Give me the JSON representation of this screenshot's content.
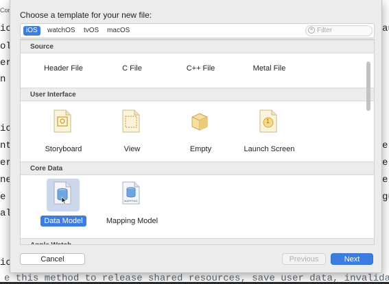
{
  "background_editor": {
    "top_tab": "Core",
    "left_fragments": [
      "ic",
      "ol",
      "er",
      "n",
      "ic",
      "nt",
      "er",
      "ne",
      "e",
      "al",
      "ic"
    ],
    "right_fragments": [
      "au",
      "e",
      "e",
      "e",
      "gu"
    ],
    "bottom_comment": "e this method to release shared resources, save user data, invalidate"
  },
  "dialog": {
    "title": "Choose a template for your new file:",
    "platforms": [
      {
        "label": "iOS",
        "selected": true
      },
      {
        "label": "watchOS",
        "selected": false
      },
      {
        "label": "tvOS",
        "selected": false
      },
      {
        "label": "macOS",
        "selected": false
      }
    ],
    "filter_placeholder": "Filter",
    "sections": [
      {
        "title": "Source",
        "items": [
          {
            "label": "Header File",
            "icon": "header-file-icon"
          },
          {
            "label": "C File",
            "icon": "c-file-icon"
          },
          {
            "label": "C++ File",
            "icon": "cpp-file-icon"
          },
          {
            "label": "Metal File",
            "icon": "metal-file-icon"
          }
        ]
      },
      {
        "title": "User Interface",
        "items": [
          {
            "label": "Storyboard",
            "icon": "storyboard-icon"
          },
          {
            "label": "View",
            "icon": "view-icon"
          },
          {
            "label": "Empty",
            "icon": "empty-icon"
          },
          {
            "label": "Launch Screen",
            "icon": "launch-screen-icon"
          }
        ]
      },
      {
        "title": "Core Data",
        "items": [
          {
            "label": "Data Model",
            "icon": "data-model-icon",
            "selected": true
          },
          {
            "label": "Mapping Model",
            "icon": "mapping-model-icon",
            "badge": "MAPPING"
          }
        ]
      },
      {
        "title": "Apple Watch",
        "items": []
      }
    ],
    "launch_screen_badge": "1",
    "buttons": {
      "cancel": "Cancel",
      "previous": "Previous",
      "next": "Next"
    }
  },
  "colors": {
    "accent": "#3d7ce0",
    "selection_bg": "#cdd7ec",
    "sheet_bg": "#ececec"
  }
}
